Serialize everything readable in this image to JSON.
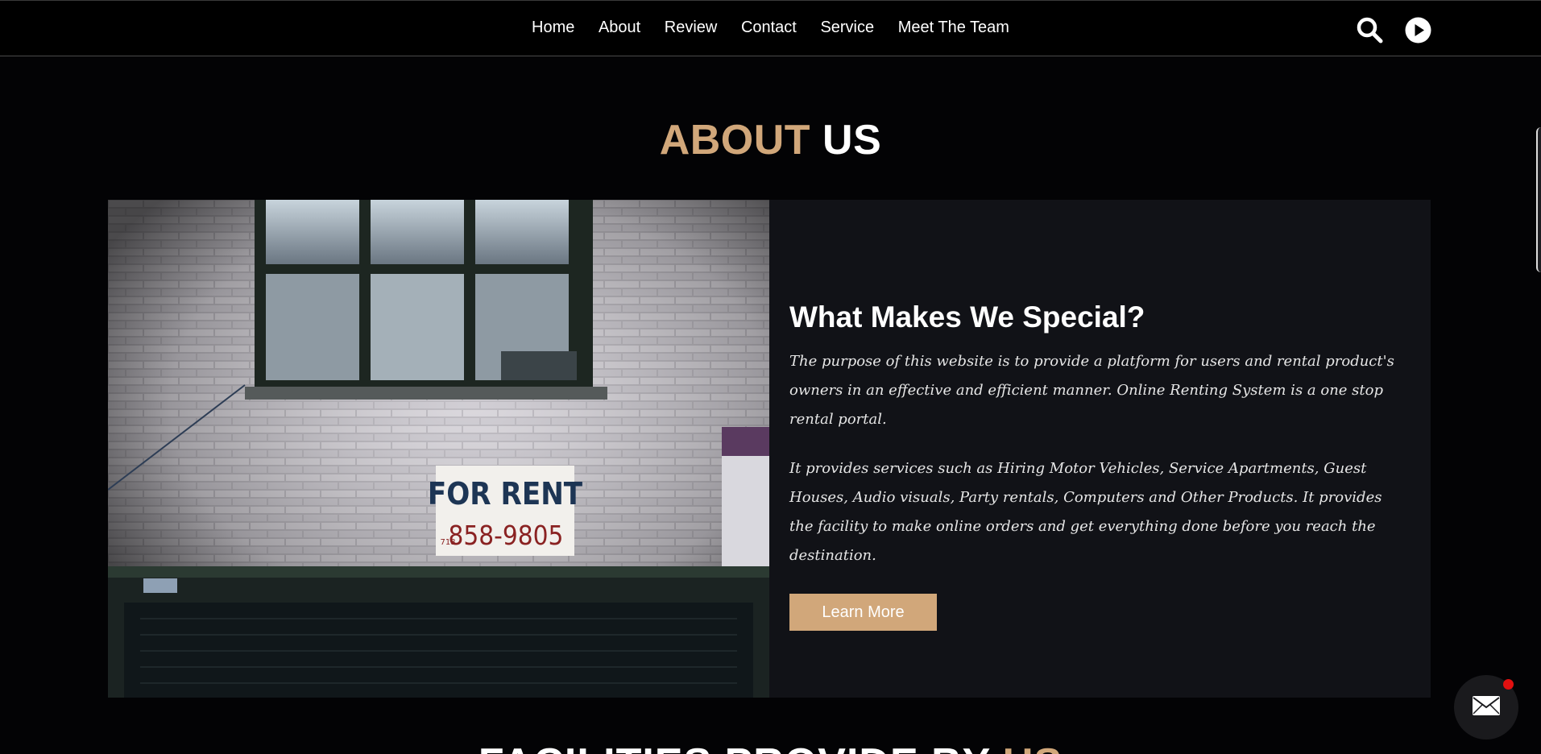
{
  "nav": {
    "links": [
      "Home",
      "About",
      "Review",
      "Contact",
      "Service",
      "Meet The Team"
    ],
    "icons": [
      "search-icon",
      "play-icon"
    ]
  },
  "about": {
    "title_accent": "ABOUT",
    "title_rest": "US",
    "heading": "What Makes We Special?",
    "paragraph1": "The purpose of this website is to provide a platform for users and rental product's owners in an effective and efficient manner. Online Renting System is a one stop rental portal.",
    "paragraph2": "It provides services such as Hiring Motor Vehicles, Service Apartments, Guest Houses, Audio visuals, Party rentals, Computers and Other Products. It provides the facility to make online orders and get everything done before you reach the destination.",
    "button_label": "Learn More",
    "photo": {
      "sign_line1": "FOR RENT",
      "sign_line2": "858-9805",
      "sign_prefix": "718"
    }
  },
  "facilities": {
    "title_main": "FACILITIES PROVIDE BY",
    "title_accent": "US"
  },
  "mail_fab_icon": "mail-icon",
  "colors": {
    "accent": "#d1a77a",
    "background": "#030305",
    "card": "#111217",
    "notification": "#e21010"
  }
}
